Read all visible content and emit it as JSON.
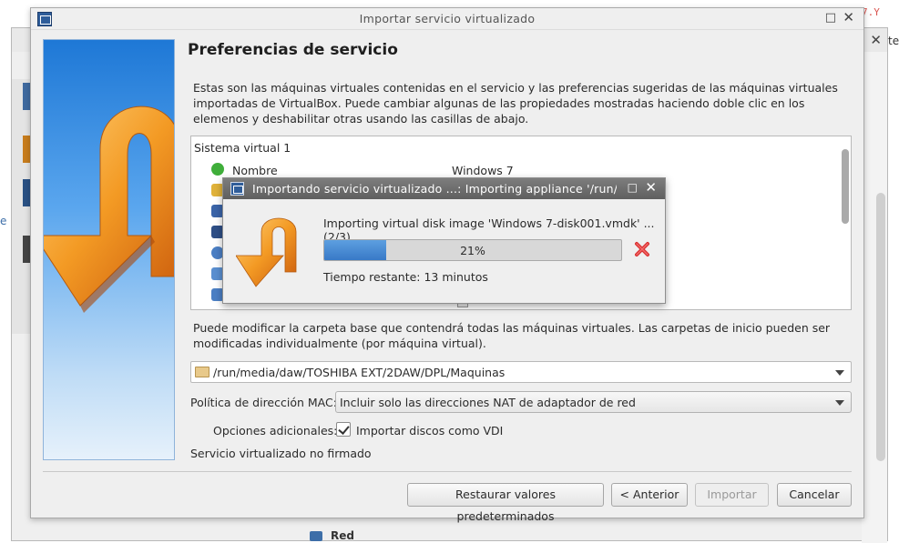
{
  "background": {
    "tag_text": "7.Y",
    "edge_text": "te",
    "blue_edge_text": "e",
    "bottom_item": "Red"
  },
  "dialog": {
    "title": "Importar servicio virtualizado",
    "page_title": "Preferencias de servicio",
    "intro": "Estas son las máquinas virtuales contenidas en el servicio y las preferencias sugeridas de las máquinas virtuales importadas de VirtualBox. Puede cambiar algunas de las propiedades mostradas haciendo doble clic en los elemenos y deshabilitar otras usando las casillas de abajo.",
    "tree": {
      "header": "Sistema virtual 1",
      "rows": [
        {
          "icon": "name-icon",
          "label": "Nombre",
          "value": "Windows 7",
          "color": "#3fae3a"
        }
      ]
    },
    "folder_desc": "Puede modificar la carpeta base que contendrá todas las máquinas virtuales. Las carpetas de inicio pueden ser modificadas individualmente (por máquina virtual).",
    "folder_value": "/run/media/daw/TOSHIBA EXT/2DAW/DPL/Maquinas",
    "mac_label": "Política de dirección MAC:",
    "mac_value": "Incluir solo las direcciones NAT de adaptador de red",
    "options_label": "Opciones adicionales:",
    "import_vdi_label": "Importar discos como VDI",
    "import_vdi_checked": true,
    "unsigned_text": "Servicio virtualizado no firmado",
    "buttons": {
      "restore": "Restaurar valores predeterminados",
      "back": "< Anterior",
      "import": "Importar",
      "cancel": "Cancelar"
    }
  },
  "progress": {
    "title": "Importando servicio virtualizado ...: Importing appliance '/run/",
    "operation": "Importing virtual disk image 'Windows 7-disk001.vmdk' ... (2/3)",
    "percent": 21,
    "percent_text": "21%",
    "remaining": "Tiempo restante: 13 minutos"
  },
  "colors": {
    "accent": "#3879c7",
    "image_orange": "#f08a1c",
    "cancel_red": "#d93030"
  }
}
